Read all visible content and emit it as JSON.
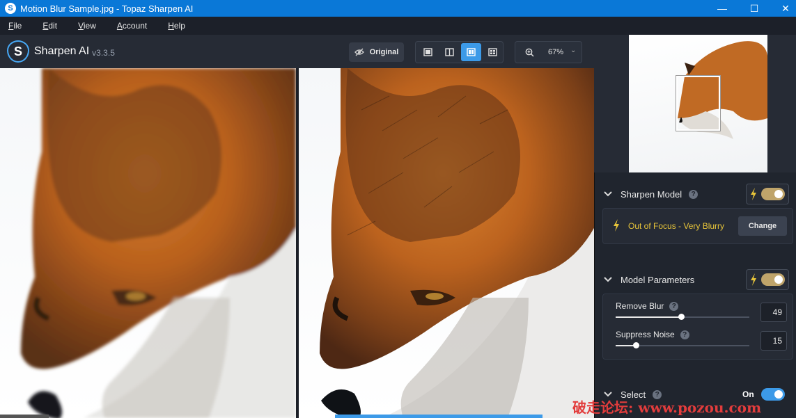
{
  "window": {
    "title": "Motion Blur Sample.jpg - Topaz Sharpen AI",
    "minimize": "—",
    "maximize": "☐",
    "close": "✕"
  },
  "menu": [
    "File",
    "Edit",
    "View",
    "Account",
    "Help"
  ],
  "app": {
    "name": "Sharpen AI",
    "version": "v3.3.5",
    "logo_letter": "S"
  },
  "toolbar": {
    "original_label": "Original",
    "zoom_value": "67%",
    "active_view": "side-by-side"
  },
  "panel": {
    "sharpen_model": {
      "title": "Sharpen Model",
      "enabled": true,
      "model": "Out of Focus - Very Blurry",
      "change_label": "Change"
    },
    "model_parameters": {
      "title": "Model Parameters",
      "enabled": true,
      "remove_blur": {
        "label": "Remove Blur",
        "value": "49",
        "level": 0.49
      },
      "suppress_noise": {
        "label": "Suppress Noise",
        "value": "15",
        "level": 0.15
      }
    },
    "select": {
      "title": "Select",
      "toggle_label": "On",
      "enabled": true
    }
  },
  "help_glyph": "?",
  "chevron": "⌄",
  "watermark": "破走论坛: www.pozou.com",
  "colors": {
    "accent": "#3c9ae8",
    "toggle_gold": "#bfa46a",
    "model_text": "#e8c53a",
    "titlebar": "#0a78d7"
  }
}
